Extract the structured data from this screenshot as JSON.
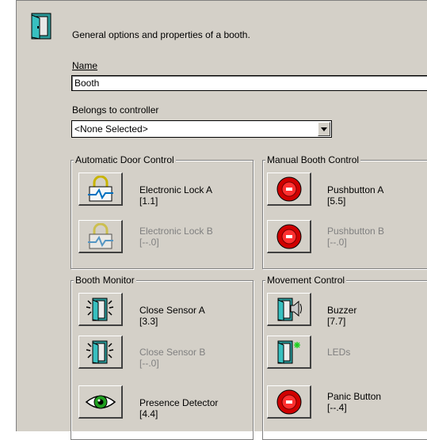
{
  "header": {
    "description": "General options and properties of a booth."
  },
  "name_field": {
    "label": "Name",
    "value": "Booth"
  },
  "controller_field": {
    "label": "Belongs to controller",
    "selected": "<None Selected>"
  },
  "groups": {
    "automatic_door": {
      "title": "Automatic Door Control",
      "items": [
        {
          "name": "Electronic Lock A",
          "address": "[1.1]",
          "enabled": true,
          "icon": "lock-icon"
        },
        {
          "name": "Electronic Lock B",
          "address": "[--.0]",
          "enabled": false,
          "icon": "lock-icon"
        }
      ]
    },
    "manual_booth": {
      "title": "Manual Booth Control",
      "items": [
        {
          "name": "Pushbutton A",
          "address": "[5.5]",
          "enabled": true,
          "icon": "red-button-icon"
        },
        {
          "name": "Pushbutton B",
          "address": "[--.0]",
          "enabled": false,
          "icon": "red-button-icon"
        }
      ]
    },
    "booth_monitor": {
      "title": "Booth Monitor",
      "items": [
        {
          "name": "Close Sensor A",
          "address": "[3.3]",
          "enabled": true,
          "icon": "door-sensor-icon"
        },
        {
          "name": "Close Sensor B",
          "address": "[--.0]",
          "enabled": false,
          "icon": "door-sensor-icon"
        },
        {
          "name": "Presence Detector",
          "address": "[4.4]",
          "enabled": true,
          "icon": "eye-icon"
        }
      ]
    },
    "movement_control": {
      "title": "Movement Control",
      "items": [
        {
          "name": "Buzzer",
          "address": "[7.7]",
          "enabled": true,
          "icon": "buzzer-icon"
        },
        {
          "name": "LEDs",
          "address": "",
          "enabled": false,
          "icon": "led-icon"
        },
        {
          "name": "Panic Button",
          "address": "[--.4]",
          "enabled": true,
          "icon": "red-button-icon"
        }
      ]
    }
  }
}
